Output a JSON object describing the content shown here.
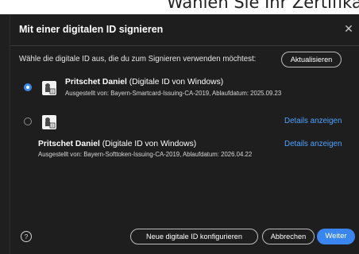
{
  "background_window": {
    "partial_text": "Wählen Sie Ihr Zertifikat aus und b"
  },
  "dialog": {
    "title": "Mit einer digitalen ID signieren",
    "close_glyph": "✕",
    "instruction": "Wähle die digitale ID aus, die du zum Signieren verwenden möchtest:",
    "refresh_label": "Aktualisieren",
    "entries": [
      {
        "selected": true,
        "icon": "certificate-icon",
        "name": "Pritschet Daniel",
        "type": "(Digitale ID von Windows)",
        "issuer": "Ausgestellt von: Bayern-Smartcard-Issuing-CA-2019, Ablaufdatum: 2025.09.23"
      },
      {
        "selected": false,
        "icon": "certificate-icon",
        "details_link": "Details anzeigen"
      },
      {
        "name": "Pritschet Daniel",
        "type": "(Digitale ID von Windows)",
        "issuer": "Ausgestellt von: Bayern-Softtoken-Issuing-CA-2019, Ablaufdatum: 2026.04.22",
        "details_link": "Details anzeigen"
      }
    ],
    "footer": {
      "help_glyph": "?",
      "configure_label": "Neue digitale ID konfigurieren",
      "cancel_label": "Abbrechen",
      "next_label": "Weiter"
    }
  },
  "colors": {
    "dialog_background": "#1e1e1e",
    "accent_blue": "#3a86f0",
    "link_blue": "#4da3ff"
  }
}
